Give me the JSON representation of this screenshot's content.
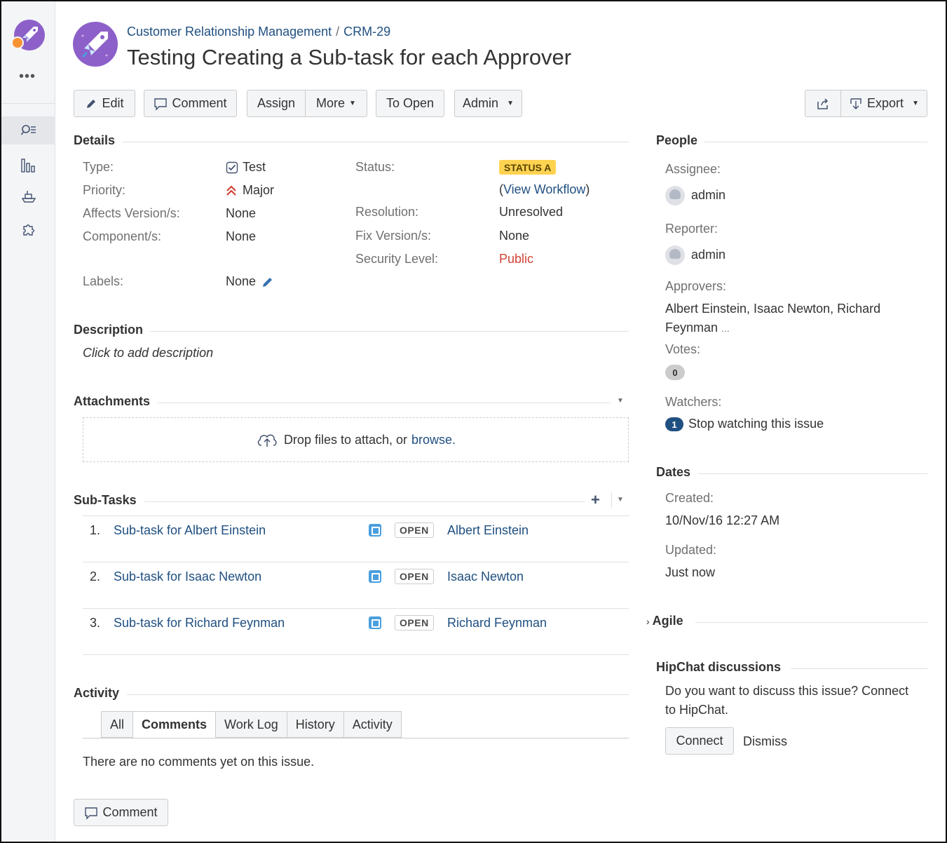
{
  "sidebar": {
    "more_label": "•••"
  },
  "breadcrumb": {
    "project": "Customer Relationship Management",
    "separator": "/",
    "issue_key": "CRM-29"
  },
  "issue": {
    "title": "Testing Creating a Sub-task for each Approver"
  },
  "toolbar": {
    "edit": "Edit",
    "comment": "Comment",
    "assign": "Assign",
    "more": "More",
    "to_open": "To Open",
    "admin": "Admin",
    "export": "Export"
  },
  "details": {
    "heading": "Details",
    "type_label": "Type:",
    "type_value": "Test",
    "priority_label": "Priority:",
    "priority_value": "Major",
    "affects_label": "Affects Version/s:",
    "affects_value": "None",
    "component_label": "Component/s:",
    "component_value": "None",
    "labels_label": "Labels:",
    "labels_value": "None",
    "status_label": "Status:",
    "status_value": "STATUS A",
    "view_workflow": "View Workflow",
    "resolution_label": "Resolution:",
    "resolution_value": "Unresolved",
    "fix_label": "Fix Version/s:",
    "fix_value": "None",
    "security_label": "Security Level:",
    "security_value": "Public"
  },
  "description": {
    "heading": "Description",
    "placeholder": "Click to add description"
  },
  "attachments": {
    "heading": "Attachments",
    "drop_text": "Drop files to attach, or",
    "browse": "browse."
  },
  "subtasks": {
    "heading": "Sub-Tasks",
    "items": [
      {
        "num": "1.",
        "title": "Sub-task for Albert Einstein",
        "status": "OPEN",
        "assignee": "Albert Einstein"
      },
      {
        "num": "2.",
        "title": "Sub-task for Isaac Newton",
        "status": "OPEN",
        "assignee": "Isaac Newton"
      },
      {
        "num": "3.",
        "title": "Sub-task for Richard Feynman",
        "status": "OPEN",
        "assignee": "Richard Feynman"
      }
    ]
  },
  "activity": {
    "heading": "Activity",
    "tabs": [
      "All",
      "Comments",
      "Work Log",
      "History",
      "Activity"
    ],
    "active_tab": "Comments",
    "empty_text": "There are no comments yet on this issue.",
    "comment_button": "Comment"
  },
  "people": {
    "heading": "People",
    "assignee_label": "Assignee:",
    "assignee": "admin",
    "reporter_label": "Reporter:",
    "reporter": "admin",
    "approvers_label": "Approvers:",
    "approvers_line1": "Albert Einstein, Isaac Newton, Richard",
    "approvers_line2": "Feynman",
    "approvers_more": "...",
    "votes_label": "Votes:",
    "votes": "0",
    "watchers_label": "Watchers:",
    "watchers_count": "1",
    "stop_watching": "Stop watching this issue"
  },
  "dates": {
    "heading": "Dates",
    "created_label": "Created:",
    "created": "10/Nov/16 12:27 AM",
    "updated_label": "Updated:",
    "updated": "Just now"
  },
  "agile": {
    "heading": "Agile"
  },
  "hipchat": {
    "heading": "HipChat discussions",
    "text_line1": "Do you want to discuss this issue? Connect",
    "text_line2": "to HipChat.",
    "connect": "Connect",
    "dismiss": "Dismiss"
  },
  "colors": {
    "link": "#205081",
    "status_lozenge": "#ffd351",
    "security_public": "#d04437",
    "priority": "#d04437",
    "project_avatar": "#8d60c9"
  }
}
